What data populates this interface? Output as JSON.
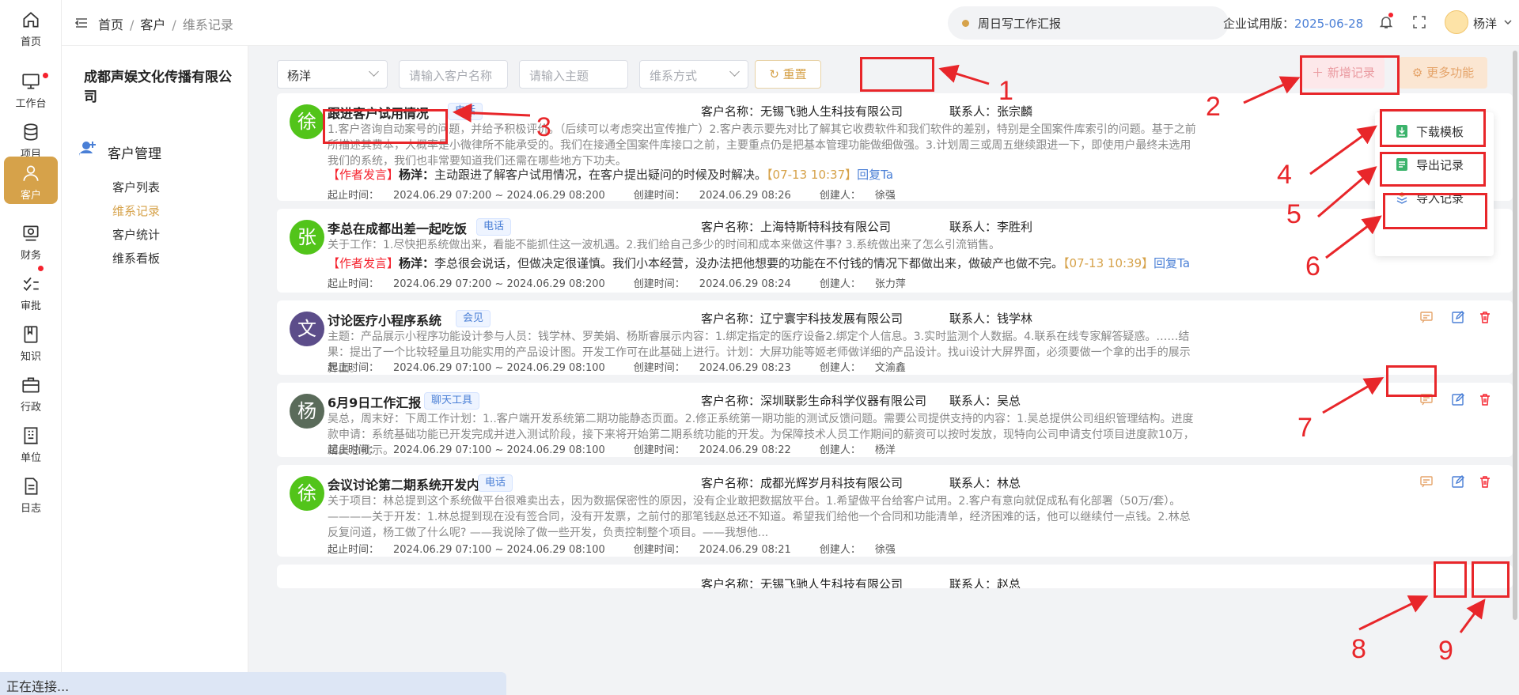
{
  "rail": [
    {
      "name": "home",
      "label": "首页"
    },
    {
      "name": "workbench",
      "label": "工作台",
      "dot": true
    },
    {
      "name": "project",
      "label": "项目"
    },
    {
      "name": "customer",
      "label": "客户",
      "active": true
    },
    {
      "name": "finance",
      "label": "财务"
    },
    {
      "name": "approval",
      "label": "审批",
      "dot": true
    },
    {
      "name": "knowledge",
      "label": "知识"
    },
    {
      "name": "admin",
      "label": "行政"
    },
    {
      "name": "unit",
      "label": "单位"
    },
    {
      "name": "log",
      "label": "日志"
    }
  ],
  "topbar": {
    "crumbs": [
      "首页",
      "客户",
      "维系记录"
    ],
    "separator": "/",
    "notice": "周日写工作汇报",
    "trial_label": "企业试用版：",
    "trial_date": "2025-06-28",
    "user": "杨洋"
  },
  "side": {
    "company": "成都声娱文化传播有限公司",
    "section": "客户管理",
    "items": [
      "客户列表",
      "维系记录",
      "客户统计",
      "维系看板"
    ],
    "active_index": 1
  },
  "filters": {
    "owner": "杨洋",
    "customer_placeholder": "请输入客户名称",
    "subject_placeholder": "请输入主题",
    "method_placeholder": "维系方式",
    "reset": "重置",
    "new_record": "新增记录",
    "more": "更多功能"
  },
  "dropdown": [
    "下载模板",
    "导出记录",
    "导入记录"
  ],
  "labels": {
    "customer": "客户名称：",
    "contact": "联系人：",
    "period": "起止时间：",
    "created": "创建时间：",
    "creator": "创建人：",
    "author_tag": "【作者发言】",
    "reply": "回复Ta"
  },
  "cards": [
    {
      "avatar": "徐",
      "avatar_color": "#52c41a",
      "title": "跟进客户试用情况",
      "tag": "电话",
      "customer": "无锡飞驰人生科技有限公司",
      "contact": "张宗麟",
      "body": "1.客户咨询自动案号的问题，并给予积极评价。（后续可以考虑突出宣传推广）2.客户表示要先对比了解其它收费软件和我们软件的差别，特别是全国案件库索引的问题。基于之前所描述其费本，大概率是小微律所不能承受的。我们在接通全国案件库接口之前，主要重点仍是把基本管理功能做细做强。3.计划周三或周五继续跟进一下，即使用户最终未选用我们的系统，我们也非常要知道我们还需在哪些地方下功夫。",
      "remark_user": "杨洋：",
      "remark": "主动跟进了解客户试用情况，在客户提出疑问的时候及时解决。",
      "remark_time": "【07-13 10:37】",
      "period": "2024.06.29 07:200 ~ 2024.06.29 08:200",
      "created": "2024.06.29 08:26",
      "creator": "徐强"
    },
    {
      "avatar": "张",
      "avatar_color": "#52c41a",
      "title": "李总在成都出差一起吃饭",
      "tag": "电话",
      "customer": "上海特斯特科技有限公司",
      "contact": "李胜利",
      "body": "关于工作：1.尽快把系统做出来，看能不能抓住这一波机遇。2.我们给自己多少的时间和成本来做这件事? 3.系统做出来了怎么引流销售。",
      "remark_user": "杨洋：",
      "remark": "李总很会说话，但做决定很谨慎。我们小本经营，没办法把他想要的功能在不付钱的情况下都做出来，做破产也做不完。",
      "remark_time": "【07-13 10:39】",
      "period": "2024.06.29 07:200 ~ 2024.06.29 08:200",
      "created": "2024.06.29 08:24",
      "creator": "张力萍"
    },
    {
      "avatar": "文",
      "avatar_color": "#5c4d8a",
      "title": "讨论医疗小程序系统",
      "tag": "会见",
      "customer": "辽宁寰宇科技发展有限公司",
      "contact": "钱学林",
      "body": "主题：产品展示小程序功能设计参与人员：钱学林、罗美娟、杨斯睿展示内容：1.绑定指定的医疗设备2.绑定个人信息。3.实时监测个人数据。4.联系在线专家解答疑惑。……结果：提出了一个比较轻量且功能实用的产品设计图。开发工作可在此基础上进行。计划：大屏功能等姬老师做详细的产品设计。找ui设计大屏界面，必须要做一个拿的出手的展示界面。",
      "period": "2024.06.29 07:100 ~ 2024.06.29 08:100",
      "created": "2024.06.29 08:23",
      "creator": "文渝鑫"
    },
    {
      "avatar": "杨",
      "avatar_color": "#5a6b5a",
      "title": "6月9日工作汇报",
      "tag": "聊天工具",
      "customer": "深圳联影生命科学仪器有限公司",
      "contact": "吴总",
      "body": "吴总，周末好：下周工作计划：1..客户端开发系统第二期功能静态页面。2.修正系统第一期功能的测试反馈问题。需要公司提供支持的内容：1.吴总提供公司组织管理结构。进度款申请：系统基础功能已开发完成并进入测试阶段，接下来将开始第二期系统功能的开发。为保障技术人员工作期间的薪资可以按时发放，现特向公司申请支付项目进度款10万，请吴总批示。",
      "period": "2024.06.29 07:100 ~ 2024.06.29 08:100",
      "created": "2024.06.29 08:22",
      "creator": "杨洋"
    },
    {
      "avatar": "徐",
      "avatar_color": "#52c41a",
      "title": "会议讨论第二期系统开发内容",
      "tag": "电话",
      "customer": "成都光辉岁月科技有限公司",
      "contact": "林总",
      "body": "关于项目：林总提到这个系统做平台很难卖出去，因为数据保密性的原因，没有企业敢把数据放平台。1.希望做平台给客户试用。2.客户有意向就促成私有化部署（50万/套）。————关于开发：1.林总提到现在没有签合同，没有开发票，之前付的那笔钱赵总还不知道。希望我们给他一个合同和功能清单，经济困难的话，他可以继续付一点钱。2.林总反复问道，杨工做了什么呢? ——我说除了做一些开发，负责控制整个项目。——我想他...",
      "period": "2024.06.29 07:100 ~ 2024.06.29 08:100",
      "created": "2024.06.29 08:21",
      "creator": "徐强"
    },
    {
      "customer": "无锡飞驰人生科技有限公司",
      "contact": "赵总"
    }
  ],
  "status_text": "正在连接...",
  "annotations": [
    "1",
    "2",
    "3",
    "4",
    "5",
    "6",
    "7",
    "8",
    "9"
  ],
  "colors": {
    "accent": "#d6a24a",
    "annotation": "#e8262a",
    "link": "#4a7fd6"
  }
}
